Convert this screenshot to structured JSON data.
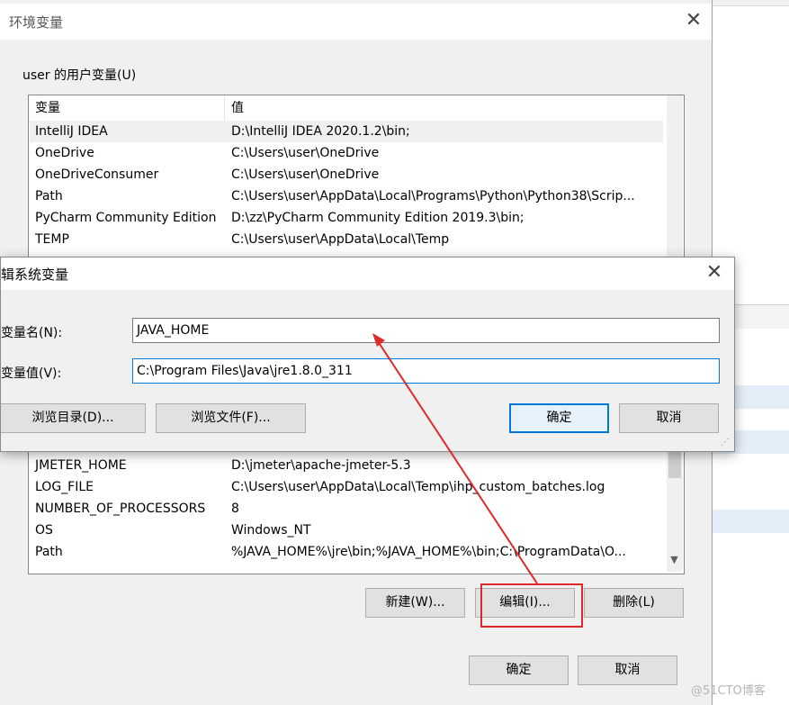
{
  "main_dialog": {
    "title": "环境变量",
    "user_vars_label": "user 的用户变量(U)",
    "columns": {
      "name": "变量",
      "value": "值"
    },
    "user_vars": [
      {
        "name": "IntelliJ IDEA",
        "value": "D:\\IntelliJ IDEA 2020.1.2\\bin;"
      },
      {
        "name": "OneDrive",
        "value": "C:\\Users\\user\\OneDrive"
      },
      {
        "name": "OneDriveConsumer",
        "value": "C:\\Users\\user\\OneDrive"
      },
      {
        "name": "Path",
        "value": "C:\\Users\\user\\AppData\\Local\\Programs\\Python\\Python38\\Scrip..."
      },
      {
        "name": "PyCharm Community Edition",
        "value": "D:\\zz\\PyCharm Community Edition 2019.3\\bin;"
      },
      {
        "name": "TEMP",
        "value": "C:\\Users\\user\\AppData\\Local\\Temp"
      }
    ],
    "system_vars": [
      {
        "name": "JMETER_HOME",
        "value": "D:\\jmeter\\apache-jmeter-5.3"
      },
      {
        "name": "LOG_FILE",
        "value": "C:\\Users\\user\\AppData\\Local\\Temp\\ihp_custom_batches.log"
      },
      {
        "name": "NUMBER_OF_PROCESSORS",
        "value": "8"
      },
      {
        "name": "OS",
        "value": "Windows_NT"
      },
      {
        "name": "Path",
        "value": "%JAVA_HOME%\\jre\\bin;%JAVA_HOME%\\bin;C:\\ProgramData\\O..."
      }
    ],
    "system_buttons": {
      "new": "新建(W)...",
      "edit": "编辑(I)...",
      "delete": "删除(L)"
    },
    "ok": "确定",
    "cancel": "取消"
  },
  "edit_dialog": {
    "title": "辑系统变量",
    "name_label": "变量名(N):",
    "name_value": "JAVA_HOME",
    "value_label": "变量值(V):",
    "value_value": "C:\\Program Files\\Java\\jre1.8.0_311",
    "browse_dir": "浏览目录(D)...",
    "browse_file": "浏览文件(F)...",
    "ok": "确定",
    "cancel": "取消"
  },
  "icons": {
    "close": "close-icon",
    "scroll_down": "chevron-down-icon",
    "grip": "resize-grip-icon"
  },
  "colors": {
    "accent": "#0078d7",
    "annotation": "#e0292a"
  },
  "watermark": "@51CTO博客"
}
